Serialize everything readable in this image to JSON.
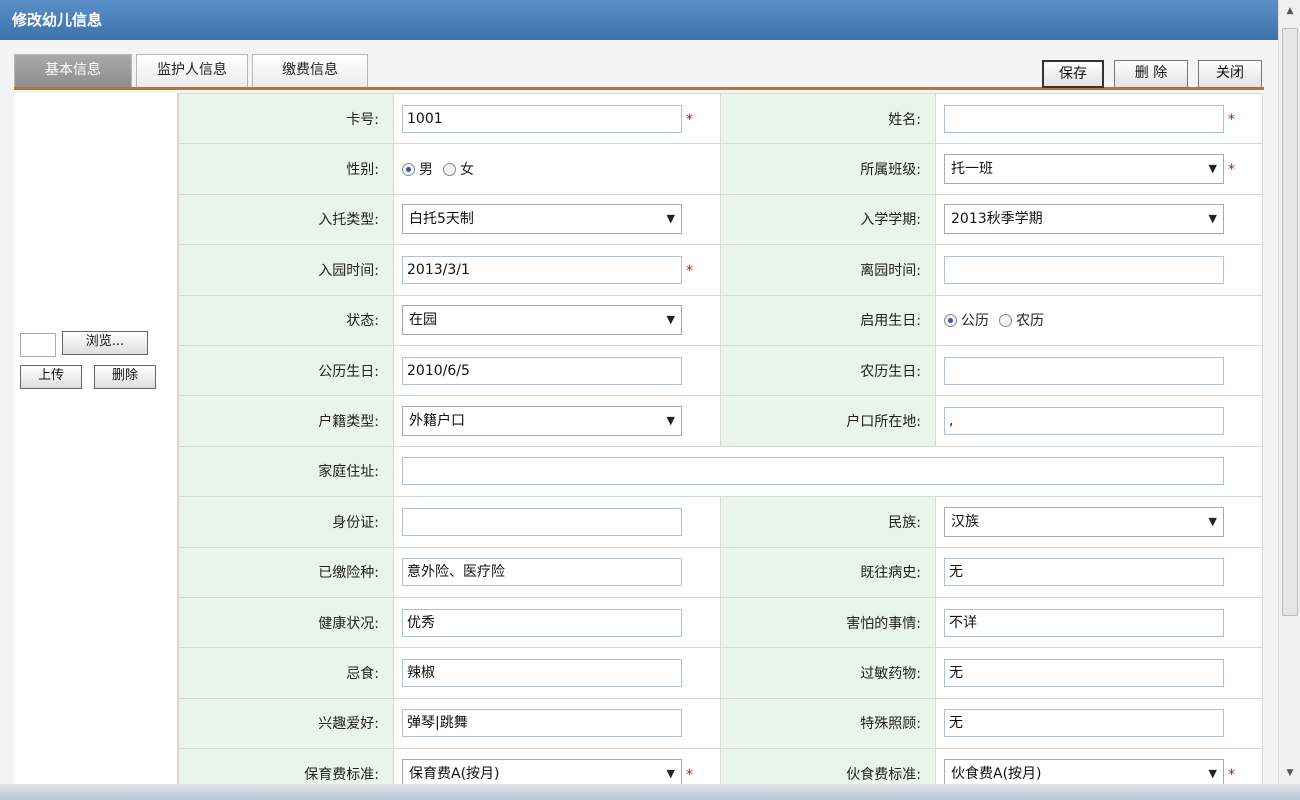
{
  "window": {
    "title": "修改幼儿信息"
  },
  "tabs": [
    "基本信息",
    "监护人信息",
    "缴费信息"
  ],
  "toolbar": {
    "save": "保存",
    "delete": "删 除",
    "close": "关闭"
  },
  "photo": {
    "browse": "浏览...",
    "upload": "上传",
    "delete": "删除"
  },
  "required_mark": "*",
  "fields": {
    "card_no": {
      "label": "卡号:",
      "value": "1001"
    },
    "name": {
      "label": "姓名:",
      "value": ""
    },
    "gender": {
      "label": "性别:",
      "options": [
        "男",
        "女"
      ],
      "selected": "男"
    },
    "class": {
      "label": "所属班级:",
      "value": "托一班"
    },
    "care_type": {
      "label": "入托类型:",
      "value": "白托5天制"
    },
    "term": {
      "label": "入学学期:",
      "value": "2013秋季学期"
    },
    "enroll_date": {
      "label": "入园时间:",
      "value": "2013/3/1"
    },
    "leave_date": {
      "label": "离园时间:",
      "value": ""
    },
    "status": {
      "label": "状态:",
      "value": "在园"
    },
    "birthday_type": {
      "label": "启用生日:",
      "options": [
        "公历",
        "农历"
      ],
      "selected": "公历"
    },
    "solar_birthday": {
      "label": "公历生日:",
      "value": "2010/6/5"
    },
    "lunar_birthday": {
      "label": "农历生日:",
      "value": ""
    },
    "hukou_type": {
      "label": "户籍类型:",
      "value": "外籍户口"
    },
    "hukou_location": {
      "label": "户口所在地:",
      "value": ","
    },
    "address": {
      "label": "家庭住址:",
      "value": ""
    },
    "id_card": {
      "label": "身份证:",
      "value": ""
    },
    "ethnicity": {
      "label": "民族:",
      "value": "汉族"
    },
    "insurance": {
      "label": "已缴险种:",
      "value": "意外险、医疗险"
    },
    "medical_history": {
      "label": "既往病史:",
      "value": "无"
    },
    "health": {
      "label": "健康状况:",
      "value": "优秀"
    },
    "fears": {
      "label": "害怕的事情:",
      "value": "不详"
    },
    "diet_taboo": {
      "label": "忌食:",
      "value": "辣椒"
    },
    "allergy": {
      "label": "过敏药物:",
      "value": "无"
    },
    "hobbies": {
      "label": "兴趣爱好:",
      "value": "弹琴|跳舞"
    },
    "special_care": {
      "label": "特殊照顾:",
      "value": "无"
    },
    "childcare_fee": {
      "label": "保育费标准:",
      "value": "保育费A(按月)"
    },
    "meal_fee": {
      "label": "伙食费标准:",
      "value": "伙食费A(按月)"
    }
  }
}
